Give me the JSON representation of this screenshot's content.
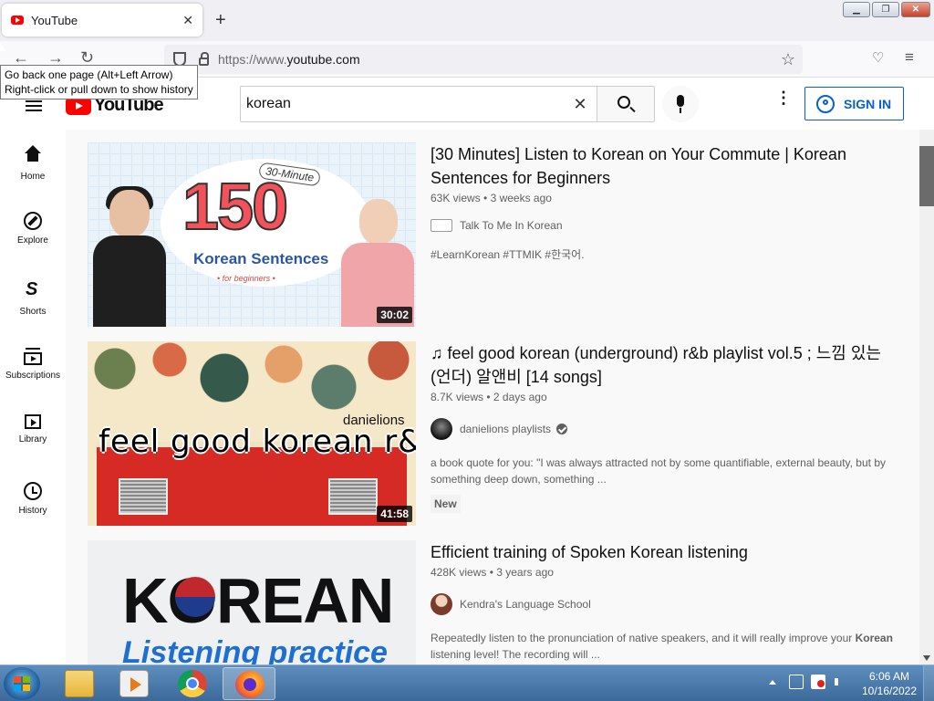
{
  "browser": {
    "tab_title": "YouTube",
    "tab_close": "✕",
    "new_tab": "+",
    "url_prefix": "https://www.",
    "url_domain": "youtube.com",
    "back": "←",
    "forward": "→",
    "reload": "↻",
    "bookmark": "☆",
    "tooltip_line1": "Go back one page (Alt+Left Arrow)",
    "tooltip_line2": "Right-click or pull down to show history",
    "window_minimize": "▁",
    "window_restore": "❐",
    "window_close": "✕",
    "menu_icon": "≡",
    "pocket_icon": "♡"
  },
  "masthead": {
    "logo_text": "YouTube",
    "search_query": "korean",
    "clear": "✕",
    "kebab": "⋮",
    "sign_in": "SIGN IN"
  },
  "sidebar": {
    "items": [
      {
        "label": "Home",
        "icon": "home-icon"
      },
      {
        "label": "Explore",
        "icon": "compass-icon"
      },
      {
        "label": "Shorts",
        "icon": "shorts-icon"
      },
      {
        "label": "Subscriptions",
        "icon": "subscriptions-icon"
      },
      {
        "label": "Library",
        "icon": "library-icon"
      },
      {
        "label": "History",
        "icon": "history-icon"
      }
    ]
  },
  "results": [
    {
      "title": "[30 Minutes] Listen to Korean on Your Commute | Korean Sentences for Beginners",
      "views": "63K views",
      "age": "3 weeks ago",
      "channel": "Talk To Me In Korean",
      "description": "#LearnKorean #TTMIK #한국어.",
      "duration": "30:02",
      "thumb_number": "150",
      "thumb_tag": "30-Minute",
      "thumb_subtitle": "Korean Sentences",
      "thumb_small": "• for beginners •"
    },
    {
      "title": "♫ feel good korean (underground) r&b playlist vol.5 ; 느낌 있는 (언더) 알앤비 [14 songs]",
      "views": "8.7K views",
      "age": "2 days ago",
      "channel": "danielions playlists",
      "description": "a book quote for you: \"I was always attracted not by some quantifiable, external beauty, but by something deep down, something ...",
      "badge": "New",
      "duration": "41:58",
      "thumb_text": "feel good korean r&b",
      "thumb_small": "danielions"
    },
    {
      "title": "Efficient training of Spoken Korean listening",
      "views": "428K views",
      "age": "3 years ago",
      "channel": "Kendra's Language School",
      "description_pre": "Repeatedly listen to the pronunciation of native speakers, and it will really improve your ",
      "description_bold": "Korean",
      "description_post": " listening level! The recording will ...",
      "thumb_text": "KOREAN",
      "thumb_subtitle": "Listening practice"
    }
  ],
  "views_separator": " • ",
  "taskbar": {
    "time": "6:06 AM",
    "date": "10/16/2022"
  },
  "colors": {
    "youtube_red": "#ff0000",
    "signin_blue": "#065fd4"
  }
}
